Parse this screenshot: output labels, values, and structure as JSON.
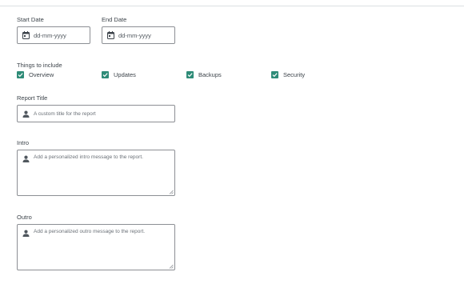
{
  "start_date": {
    "label": "Start Date",
    "placeholder": "dd-mm-yyyy"
  },
  "end_date": {
    "label": "End Date",
    "placeholder": "dd-mm-yyyy"
  },
  "things_to_include": {
    "label": "Things to include",
    "options": [
      {
        "label": "Overview",
        "checked": true
      },
      {
        "label": "Updates",
        "checked": true
      },
      {
        "label": "Backups",
        "checked": true
      },
      {
        "label": "Security",
        "checked": true
      }
    ]
  },
  "report_title": {
    "label": "Report Title",
    "placeholder": "A custom title for the report"
  },
  "intro": {
    "label": "Intro",
    "placeholder": "Add a personalized intro message to the report."
  },
  "outro": {
    "label": "Outro",
    "placeholder": "Add a personalized outro message to the report."
  },
  "colors": {
    "accent": "#2e8b77",
    "border": "#8c8f94",
    "text": "#3c434a"
  },
  "icons": {
    "date": "calendar-icon",
    "field": "person-icon",
    "check": "checkmark-icon"
  }
}
